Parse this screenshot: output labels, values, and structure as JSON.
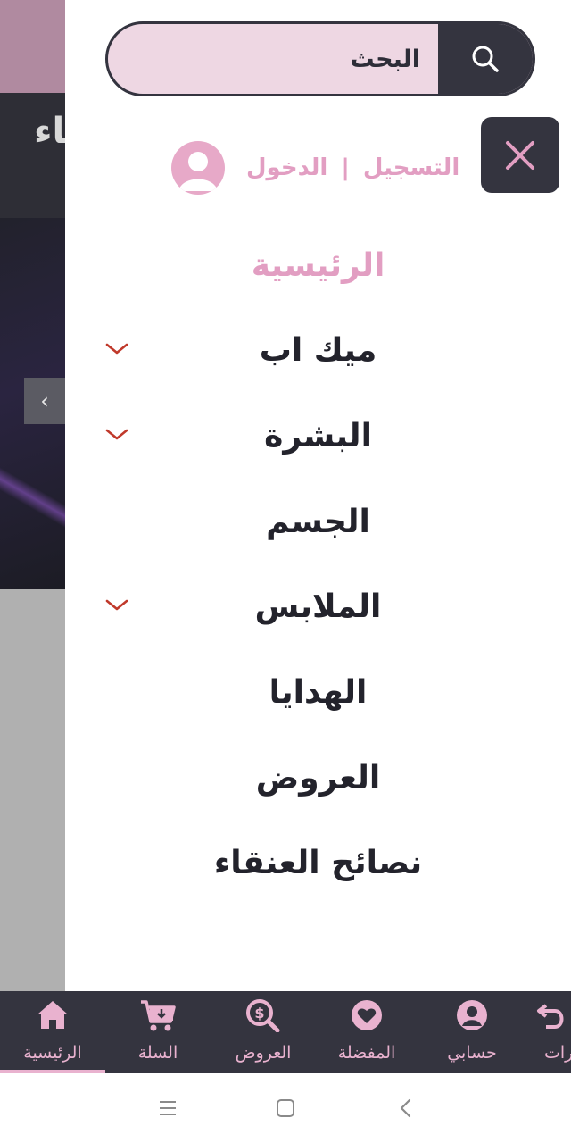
{
  "search": {
    "placeholder": "البحث"
  },
  "background": {
    "logo_text": "العنقاء"
  },
  "drawer": {
    "auth": {
      "register": "التسجيل",
      "separator": "|",
      "login": "الدخول"
    },
    "menu": [
      {
        "label": "الرئيسية",
        "active": true,
        "has_submenu": false
      },
      {
        "label": "ميك اب",
        "active": false,
        "has_submenu": true
      },
      {
        "label": "البشرة",
        "active": false,
        "has_submenu": true
      },
      {
        "label": "الجسم",
        "active": false,
        "has_submenu": false
      },
      {
        "label": "الملابس",
        "active": false,
        "has_submenu": true
      },
      {
        "label": "الهدايا",
        "active": false,
        "has_submenu": false
      },
      {
        "label": "العروض",
        "active": false,
        "has_submenu": false
      },
      {
        "label": "نصائح العنقاء",
        "active": false,
        "has_submenu": false
      }
    ]
  },
  "bottom_nav": [
    {
      "label": "الرئيسية",
      "icon": "home-icon",
      "active": true
    },
    {
      "label": "السلة",
      "icon": "cart-icon",
      "active": false
    },
    {
      "label": "العروض",
      "icon": "offers-icon",
      "active": false
    },
    {
      "label": "المفضلة",
      "icon": "heart-icon",
      "active": false
    },
    {
      "label": "حسابي",
      "icon": "user-icon",
      "active": false
    },
    {
      "label": "ـرات",
      "icon": "return-icon",
      "active": false
    }
  ],
  "colors": {
    "accent_pink": "#e29ec2",
    "dark": "#34343f",
    "search_bg": "#eed7e3",
    "chevron_red": "#c0392b"
  }
}
